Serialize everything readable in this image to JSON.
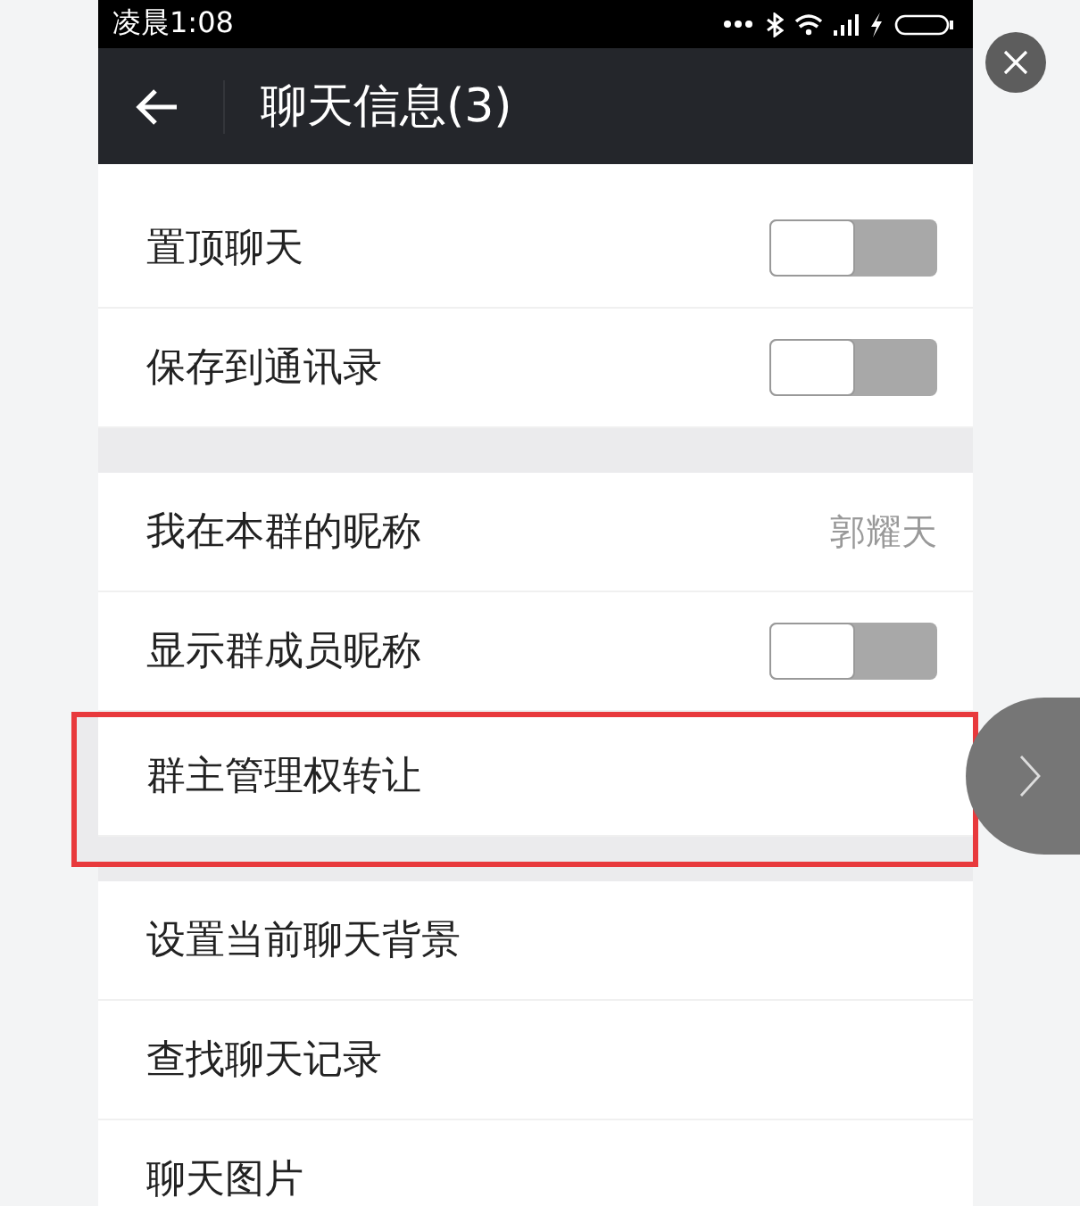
{
  "status_bar": {
    "time": "凌晨1:08"
  },
  "header": {
    "title": "聊天信息(3)"
  },
  "sections": [
    {
      "items": [
        {
          "kind": "toggle",
          "label": "置顶聊天",
          "on": false,
          "highlighted": false
        },
        {
          "kind": "toggle",
          "label": "保存到通讯录",
          "on": false,
          "highlighted": false
        }
      ]
    },
    {
      "items": [
        {
          "kind": "value",
          "label": "我在本群的昵称",
          "value": "郭耀天",
          "highlighted": false
        },
        {
          "kind": "toggle",
          "label": "显示群成员昵称",
          "on": false,
          "highlighted": false
        },
        {
          "kind": "link",
          "label": "群主管理权转让",
          "highlighted": true
        }
      ]
    },
    {
      "items": [
        {
          "kind": "link",
          "label": "设置当前聊天背景",
          "highlighted": false
        },
        {
          "kind": "link",
          "label": "查找聊天记录",
          "highlighted": false
        },
        {
          "kind": "link",
          "label": "聊天图片",
          "highlighted": false
        }
      ]
    }
  ]
}
